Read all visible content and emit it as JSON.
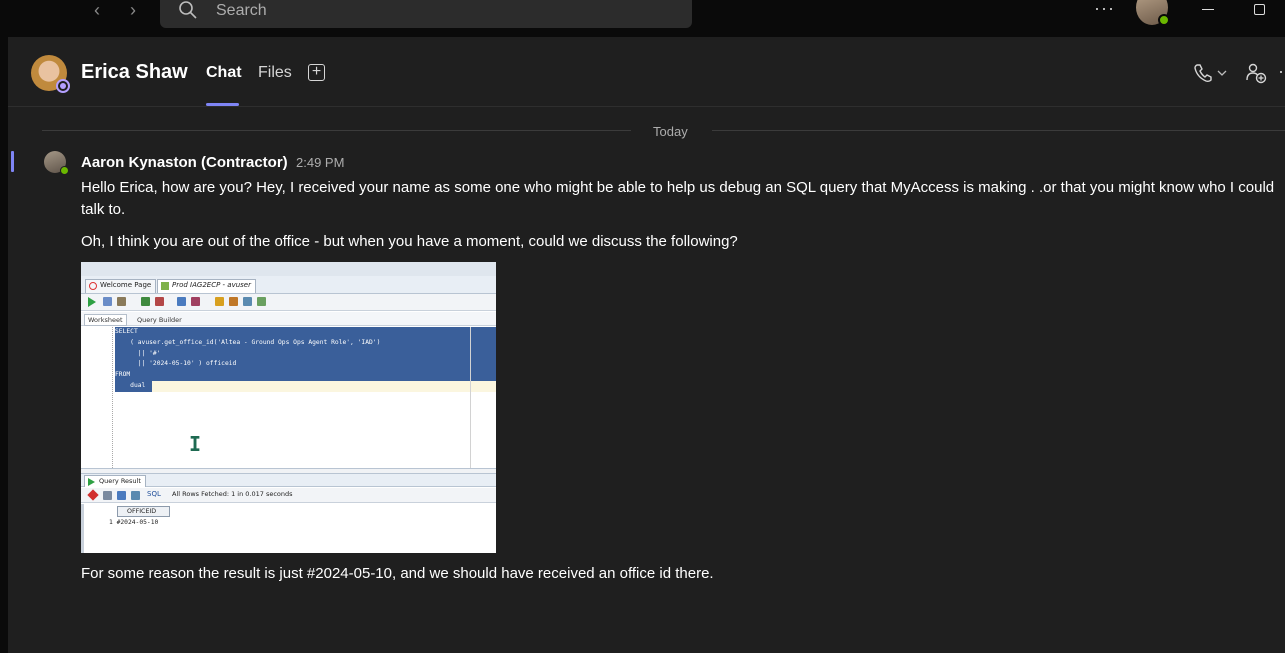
{
  "titlebar": {
    "search_placeholder": "Search",
    "more_label": "···",
    "back_glyph": "‹",
    "forward_glyph": "›"
  },
  "header": {
    "contact_name": "Erica Shaw",
    "tabs": [
      {
        "label": "Chat",
        "active": true
      },
      {
        "label": "Files",
        "active": false
      }
    ],
    "more_label": "··"
  },
  "conversation": {
    "divider_label": "Today",
    "message": {
      "sender": "Aaron Kynaston (Contractor)",
      "time": "2:49 PM",
      "paragraphs": [
        "Hello Erica, how are you? Hey, I received your name as some one who might be able to help us debug an SQL query that MyAccess is making . .or that you might know who I could talk to.",
        "Oh, I think you are out of the office - but when you have a moment, could we discuss the following?",
        "For some reason the result is just #2024-05-10, and we should have received an office id there."
      ]
    }
  },
  "screenshot": {
    "tabs": [
      "Welcome Page",
      "Prod IAG2ECP - avuser"
    ],
    "subtabs": [
      "Worksheet",
      "Query Builder"
    ],
    "code_lines": [
      "SELECT",
      "    ( avuser.get_office_id('Altea - Ground Ops Ops Agent Role', 'IAD')",
      "      || '#'",
      "      || '2024-05-10' ) officeid",
      "FROM",
      "    dual"
    ],
    "result_tab": "Query Result",
    "sql_label": "SQL",
    "fetch_status": "All Rows Fetched: 1 in 0.017 seconds",
    "column_header": "OFFICEID",
    "row_number": "1",
    "row_value": "#2024-05-10"
  },
  "colors": {
    "accent": "#7f85f5",
    "available": "#6bb700",
    "background": "#1f1f1f",
    "titlebar": "#0a0a0a"
  }
}
